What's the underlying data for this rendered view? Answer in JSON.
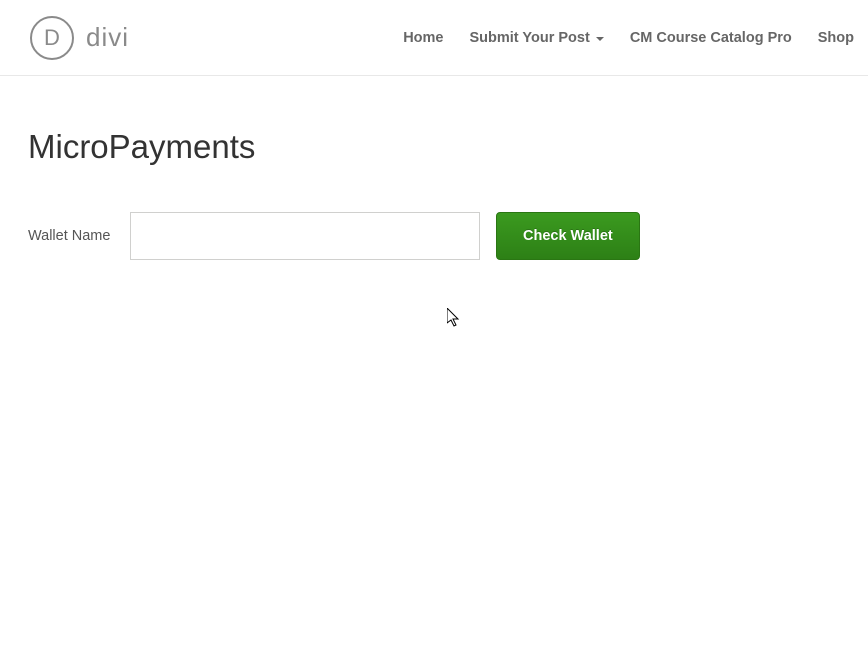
{
  "logo": {
    "icon_letter": "D",
    "text": "divi"
  },
  "nav": {
    "items": [
      {
        "label": "Home"
      },
      {
        "label": "Submit Your Post",
        "has_dropdown": true
      },
      {
        "label": "CM Course Catalog Pro"
      },
      {
        "label": "Shop"
      }
    ]
  },
  "page": {
    "title": "MicroPayments"
  },
  "form": {
    "wallet_label": "Wallet Name",
    "wallet_value": "",
    "check_button_label": "Check Wallet"
  }
}
